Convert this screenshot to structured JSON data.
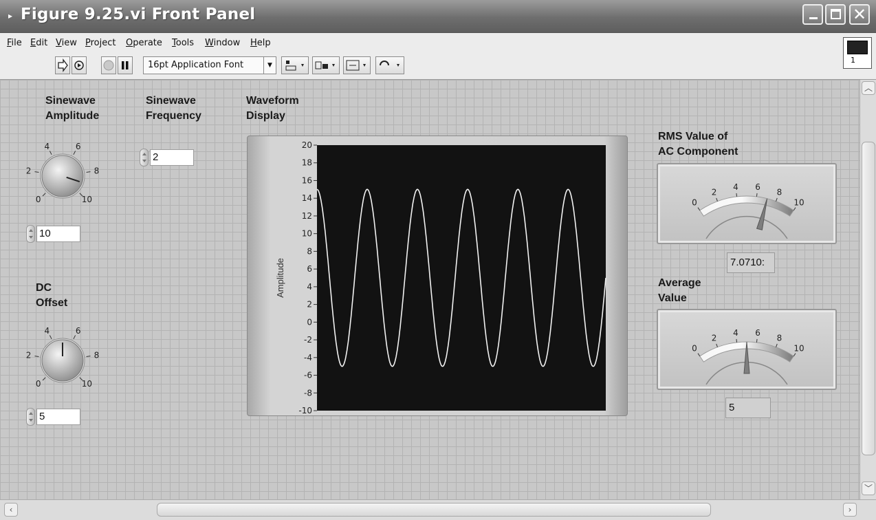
{
  "window": {
    "title": "Figure 9.25.vi Front Panel"
  },
  "menu": [
    "File",
    "Edit",
    "View",
    "Project",
    "Operate",
    "Tools",
    "Window",
    "Help"
  ],
  "toolbar": {
    "font": "16pt Application Font",
    "vi_icon_number": "1",
    "help_label": "?"
  },
  "controls": {
    "amplitude": {
      "label": [
        "Sinewave",
        "Amplitude"
      ],
      "value": "10",
      "scale": [
        "0",
        "2",
        "4",
        "6",
        "8",
        "10"
      ],
      "knob_value": 9
    },
    "frequency": {
      "label": [
        "Sinewave",
        "Frequency"
      ],
      "value": "2"
    },
    "dc_offset": {
      "label": [
        "DC",
        "Offset"
      ],
      "value": "5",
      "scale": [
        "0",
        "2",
        "4",
        "6",
        "8",
        "10"
      ],
      "knob_value": 5
    }
  },
  "graph": {
    "label": [
      "Waveform",
      "Display"
    ],
    "ylabel": "Amplitude",
    "yticks": [
      "20",
      "18",
      "16",
      "14",
      "12",
      "10",
      "8",
      "6",
      "4",
      "2",
      "0",
      "-2",
      "-4",
      "-6",
      "-8",
      "-10"
    ],
    "ymin": -10,
    "ymax": 20,
    "series": {
      "offset": 5,
      "amplitude": 10,
      "cycles": 5.75,
      "phase_deg": 90
    },
    "plot_color": "#f2f2f2",
    "background": "#121212"
  },
  "indicators": {
    "rms": {
      "label": [
        "RMS Value of",
        "AC Component"
      ],
      "value": "7.0710:",
      "needle": 7.07,
      "scale": [
        "0",
        "2",
        "4",
        "6",
        "8",
        "10"
      ]
    },
    "average": {
      "label": [
        "Average",
        "Value"
      ],
      "value": "5",
      "needle": 5,
      "scale": [
        "0",
        "2",
        "4",
        "6",
        "8",
        "10"
      ]
    }
  }
}
